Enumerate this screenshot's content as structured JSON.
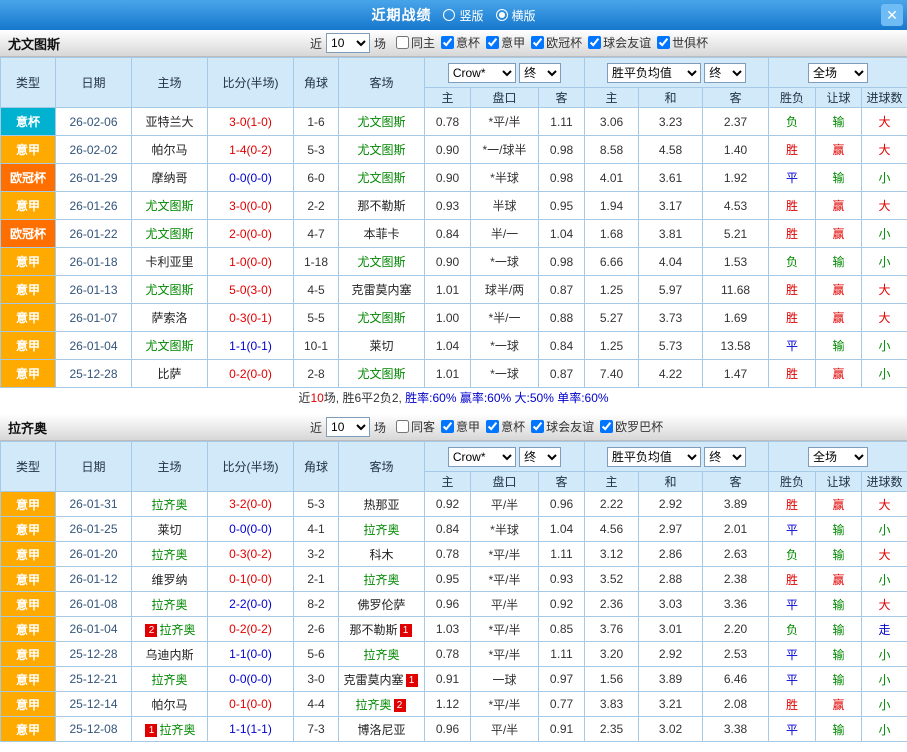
{
  "topbar": {
    "title": "近期战绩",
    "vertical_label": "竖版",
    "horizontal_label": "横版",
    "selected_layout": "横版",
    "close_glyph": "✕"
  },
  "controls": {
    "prefix": "近",
    "count": "10",
    "suffix": "场"
  },
  "palette": {
    "league": {
      "意杯": "#00b2cf",
      "意甲": "#ffaa00",
      "欧冠杯": "#ff6f00"
    },
    "score": {
      "red": "#e10000",
      "blue": "#0000d0"
    },
    "result": {
      "胜": "#e10000",
      "赢": "#e10000",
      "大": "#e10000",
      "平": "#0000d0",
      "走": "#0000d0",
      "负": "#008800",
      "输": "#008800",
      "小": "#008800"
    },
    "focal_team": "#008800"
  },
  "sections": [
    {
      "team": "尤文图斯",
      "filters": [
        {
          "label": "同主",
          "checked": false
        },
        {
          "label": "意杯",
          "checked": true
        },
        {
          "label": "意甲",
          "checked": true
        },
        {
          "label": "欧冠杯",
          "checked": true
        },
        {
          "label": "球会友谊",
          "checked": true
        },
        {
          "label": "世俱杯",
          "checked": true
        }
      ],
      "header": {
        "type": "类型",
        "date": "日期",
        "home": "主场",
        "score": "比分(半场)",
        "corner": "角球",
        "away": "客场",
        "odds_select": "Crow*",
        "odds_time": "终",
        "mean_select": "胜平负均值",
        "mean_time": "终",
        "scope_select": "全场",
        "sub": [
          "主",
          "盘口",
          "客",
          "主",
          "和",
          "客",
          "胜负",
          "让球",
          "进球数"
        ]
      },
      "rows": [
        {
          "type": "意杯",
          "date": "26-02-06",
          "home": "亚特兰大",
          "home_focal": false,
          "score": "3-0(1-0)",
          "score_style": "red",
          "corner": "1-6",
          "away": "尤文图斯",
          "away_focal": true,
          "odds_home": "0.78",
          "handicap": "*平/半",
          "odds_away": "1.11",
          "mean_home": "3.06",
          "mean_draw": "3.23",
          "mean_away": "2.37",
          "res_wdl": "负",
          "res_ah": "输",
          "res_ou": "大"
        },
        {
          "type": "意甲",
          "date": "26-02-02",
          "home": "帕尔马",
          "home_focal": false,
          "score": "1-4(0-2)",
          "score_style": "red",
          "corner": "5-3",
          "away": "尤文图斯",
          "away_focal": true,
          "odds_home": "0.90",
          "handicap": "*一/球半",
          "odds_away": "0.98",
          "mean_home": "8.58",
          "mean_draw": "4.58",
          "mean_away": "1.40",
          "res_wdl": "胜",
          "res_ah": "赢",
          "res_ou": "大"
        },
        {
          "type": "欧冠杯",
          "date": "26-01-29",
          "home": "摩纳哥",
          "home_focal": false,
          "score": "0-0(0-0)",
          "score_style": "blue",
          "corner": "6-0",
          "away": "尤文图斯",
          "away_focal": true,
          "odds_home": "0.90",
          "handicap": "*半球",
          "odds_away": "0.98",
          "mean_home": "4.01",
          "mean_draw": "3.61",
          "mean_away": "1.92",
          "res_wdl": "平",
          "res_ah": "输",
          "res_ou": "小"
        },
        {
          "type": "意甲",
          "date": "26-01-26",
          "home": "尤文图斯",
          "home_focal": true,
          "score": "3-0(0-0)",
          "score_style": "red",
          "corner": "2-2",
          "away": "那不勒斯",
          "away_focal": false,
          "odds_home": "0.93",
          "handicap": "半球",
          "odds_away": "0.95",
          "mean_home": "1.94",
          "mean_draw": "3.17",
          "mean_away": "4.53",
          "res_wdl": "胜",
          "res_ah": "赢",
          "res_ou": "大"
        },
        {
          "type": "欧冠杯",
          "date": "26-01-22",
          "home": "尤文图斯",
          "home_focal": true,
          "score": "2-0(0-0)",
          "score_style": "red",
          "corner": "4-7",
          "away": "本菲卡",
          "away_focal": false,
          "odds_home": "0.84",
          "handicap": "半/一",
          "odds_away": "1.04",
          "mean_home": "1.68",
          "mean_draw": "3.81",
          "mean_away": "5.21",
          "res_wdl": "胜",
          "res_ah": "赢",
          "res_ou": "小"
        },
        {
          "type": "意甲",
          "date": "26-01-18",
          "home": "卡利亚里",
          "home_focal": false,
          "score": "1-0(0-0)",
          "score_style": "red",
          "corner": "1-18",
          "away": "尤文图斯",
          "away_focal": true,
          "odds_home": "0.90",
          "handicap": "*一球",
          "odds_away": "0.98",
          "mean_home": "6.66",
          "mean_draw": "4.04",
          "mean_away": "1.53",
          "res_wdl": "负",
          "res_ah": "输",
          "res_ou": "小"
        },
        {
          "type": "意甲",
          "date": "26-01-13",
          "home": "尤文图斯",
          "home_focal": true,
          "score": "5-0(3-0)",
          "score_style": "red",
          "corner": "4-5",
          "away": "克雷莫内塞",
          "away_focal": false,
          "odds_home": "1.01",
          "handicap": "球半/两",
          "odds_away": "0.87",
          "mean_home": "1.25",
          "mean_draw": "5.97",
          "mean_away": "11.68",
          "res_wdl": "胜",
          "res_ah": "赢",
          "res_ou": "大"
        },
        {
          "type": "意甲",
          "date": "26-01-07",
          "home": "萨索洛",
          "home_focal": false,
          "score": "0-3(0-1)",
          "score_style": "red",
          "corner": "5-5",
          "away": "尤文图斯",
          "away_focal": true,
          "odds_home": "1.00",
          "handicap": "*半/一",
          "odds_away": "0.88",
          "mean_home": "5.27",
          "mean_draw": "3.73",
          "mean_away": "1.69",
          "res_wdl": "胜",
          "res_ah": "赢",
          "res_ou": "大"
        },
        {
          "type": "意甲",
          "date": "26-01-04",
          "home": "尤文图斯",
          "home_focal": true,
          "score": "1-1(0-1)",
          "score_style": "blue",
          "corner": "10-1",
          "away": "莱切",
          "away_focal": false,
          "odds_home": "1.04",
          "handicap": "*一球",
          "odds_away": "0.84",
          "mean_home": "1.25",
          "mean_draw": "5.73",
          "mean_away": "13.58",
          "res_wdl": "平",
          "res_ah": "输",
          "res_ou": "小"
        },
        {
          "type": "意甲",
          "date": "25-12-28",
          "home": "比萨",
          "home_focal": false,
          "score": "0-2(0-0)",
          "score_style": "red",
          "corner": "2-8",
          "away": "尤文图斯",
          "away_focal": true,
          "odds_home": "1.01",
          "handicap": "*一球",
          "odds_away": "0.87",
          "mean_home": "7.40",
          "mean_draw": "4.22",
          "mean_away": "1.47",
          "res_wdl": "胜",
          "res_ah": "赢",
          "res_ou": "小"
        }
      ],
      "summary": [
        {
          "text": "近",
          "color": "#333333"
        },
        {
          "text": "10",
          "color": "#e10000"
        },
        {
          "text": "场, 胜6平2负2, ",
          "color": "#333333"
        },
        {
          "text": "胜率:60% ",
          "color": "#0000cc"
        },
        {
          "text": "赢率:60% ",
          "color": "#0000cc"
        },
        {
          "text": "大:50% ",
          "color": "#0000cc"
        },
        {
          "text": "单率:60%",
          "color": "#0000cc"
        }
      ]
    },
    {
      "team": "拉齐奥",
      "filters": [
        {
          "label": "同客",
          "checked": false
        },
        {
          "label": "意甲",
          "checked": true
        },
        {
          "label": "意杯",
          "checked": true
        },
        {
          "label": "球会友谊",
          "checked": true
        },
        {
          "label": "欧罗巴杯",
          "checked": true
        }
      ],
      "header": {
        "type": "类型",
        "date": "日期",
        "home": "主场",
        "score": "比分(半场)",
        "corner": "角球",
        "away": "客场",
        "odds_select": "Crow*",
        "odds_time": "终",
        "mean_select": "胜平负均值",
        "mean_time": "终",
        "scope_select": "全场",
        "sub": [
          "主",
          "盘口",
          "客",
          "主",
          "和",
          "客",
          "胜负",
          "让球",
          "进球数"
        ]
      },
      "rows": [
        {
          "type": "意甲",
          "date": "26-01-31",
          "home": "拉齐奥",
          "home_focal": true,
          "score": "3-2(0-0)",
          "score_style": "red",
          "corner": "5-3",
          "away": "热那亚",
          "away_focal": false,
          "odds_home": "0.92",
          "handicap": "平/半",
          "odds_away": "0.96",
          "mean_home": "2.22",
          "mean_draw": "2.92",
          "mean_away": "3.89",
          "res_wdl": "胜",
          "res_ah": "赢",
          "res_ou": "大"
        },
        {
          "type": "意甲",
          "date": "26-01-25",
          "home": "莱切",
          "home_focal": false,
          "score": "0-0(0-0)",
          "score_style": "blue",
          "corner": "4-1",
          "away": "拉齐奥",
          "away_focal": true,
          "odds_home": "0.84",
          "handicap": "*半球",
          "odds_away": "1.04",
          "mean_home": "4.56",
          "mean_draw": "2.97",
          "mean_away": "2.01",
          "res_wdl": "平",
          "res_ah": "输",
          "res_ou": "小"
        },
        {
          "type": "意甲",
          "date": "26-01-20",
          "home": "拉齐奥",
          "home_focal": true,
          "score": "0-3(0-2)",
          "score_style": "red",
          "corner": "3-2",
          "away": "科木",
          "away_focal": false,
          "odds_home": "0.78",
          "handicap": "*平/半",
          "odds_away": "1.11",
          "mean_home": "3.12",
          "mean_draw": "2.86",
          "mean_away": "2.63",
          "res_wdl": "负",
          "res_ah": "输",
          "res_ou": "大"
        },
        {
          "type": "意甲",
          "date": "26-01-12",
          "home": "维罗纳",
          "home_focal": false,
          "score": "0-1(0-0)",
          "score_style": "red",
          "corner": "2-1",
          "away": "拉齐奥",
          "away_focal": true,
          "odds_home": "0.95",
          "handicap": "*平/半",
          "odds_away": "0.93",
          "mean_home": "3.52",
          "mean_draw": "2.88",
          "mean_away": "2.38",
          "res_wdl": "胜",
          "res_ah": "赢",
          "res_ou": "小"
        },
        {
          "type": "意甲",
          "date": "26-01-08",
          "home": "拉齐奥",
          "home_focal": true,
          "score": "2-2(0-0)",
          "score_style": "blue",
          "corner": "8-2",
          "away": "佛罗伦萨",
          "away_focal": false,
          "odds_home": "0.96",
          "handicap": "平/半",
          "odds_away": "0.92",
          "mean_home": "2.36",
          "mean_draw": "3.03",
          "mean_away": "3.36",
          "res_wdl": "平",
          "res_ah": "输",
          "res_ou": "大"
        },
        {
          "type": "意甲",
          "date": "26-01-04",
          "home": "拉齐奥",
          "home_focal": true,
          "home_pre": "2",
          "score": "0-2(0-2)",
          "score_style": "red",
          "corner": "2-6",
          "away": "那不勒斯",
          "away_focal": false,
          "away_post": "1",
          "odds_home": "1.03",
          "handicap": "*平/半",
          "odds_away": "0.85",
          "mean_home": "3.76",
          "mean_draw": "3.01",
          "mean_away": "2.20",
          "res_wdl": "负",
          "res_ah": "输",
          "res_ou": "走"
        },
        {
          "type": "意甲",
          "date": "25-12-28",
          "home": "乌迪内斯",
          "home_focal": false,
          "score": "1-1(0-0)",
          "score_style": "blue",
          "corner": "5-6",
          "away": "拉齐奥",
          "away_focal": true,
          "odds_home": "0.78",
          "handicap": "*平/半",
          "odds_away": "1.11",
          "mean_home": "3.20",
          "mean_draw": "2.92",
          "mean_away": "2.53",
          "res_wdl": "平",
          "res_ah": "输",
          "res_ou": "小"
        },
        {
          "type": "意甲",
          "date": "25-12-21",
          "home": "拉齐奥",
          "home_focal": true,
          "score": "0-0(0-0)",
          "score_style": "blue",
          "corner": "3-0",
          "away": "克雷莫内塞",
          "away_focal": false,
          "away_post": "1",
          "odds_home": "0.91",
          "handicap": "一球",
          "odds_away": "0.97",
          "mean_home": "1.56",
          "mean_draw": "3.89",
          "mean_away": "6.46",
          "res_wdl": "平",
          "res_ah": "输",
          "res_ou": "小"
        },
        {
          "type": "意甲",
          "date": "25-12-14",
          "home": "帕尔马",
          "home_focal": false,
          "score": "0-1(0-0)",
          "score_style": "red",
          "corner": "4-4",
          "away": "拉齐奥",
          "away_focal": true,
          "away_post": "2",
          "odds_home": "1.12",
          "handicap": "*平/半",
          "odds_away": "0.77",
          "mean_home": "3.83",
          "mean_draw": "3.21",
          "mean_away": "2.08",
          "res_wdl": "胜",
          "res_ah": "赢",
          "res_ou": "小"
        },
        {
          "type": "意甲",
          "date": "25-12-08",
          "home": "拉齐奥",
          "home_focal": true,
          "home_pre": "1",
          "score": "1-1(1-1)",
          "score_style": "blue",
          "corner": "7-3",
          "away": "博洛尼亚",
          "away_focal": false,
          "odds_home": "0.96",
          "handicap": "平/半",
          "odds_away": "0.91",
          "mean_home": "2.35",
          "mean_draw": "3.02",
          "mean_away": "3.38",
          "res_wdl": "平",
          "res_ah": "输",
          "res_ou": "小"
        }
      ]
    }
  ]
}
